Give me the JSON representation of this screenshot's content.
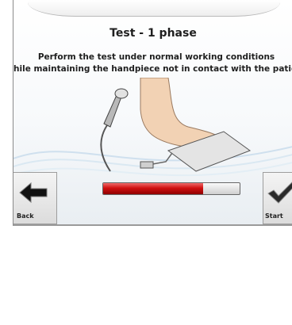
{
  "screen": {
    "title": "Test - 1 phase",
    "description_line1": "Perform the test under normal working conditions",
    "description_line2": "while maintaining the handpiece not in contact with the patient"
  },
  "buttons": {
    "back_label": "Back",
    "start_label": "Start"
  },
  "progress": {
    "fraction": 0.73
  },
  "colors": {
    "accent_red": "#c81414",
    "skin": "#f2d2b4"
  },
  "icons": {
    "back": "left-arrow-icon",
    "start": "check-icon"
  }
}
